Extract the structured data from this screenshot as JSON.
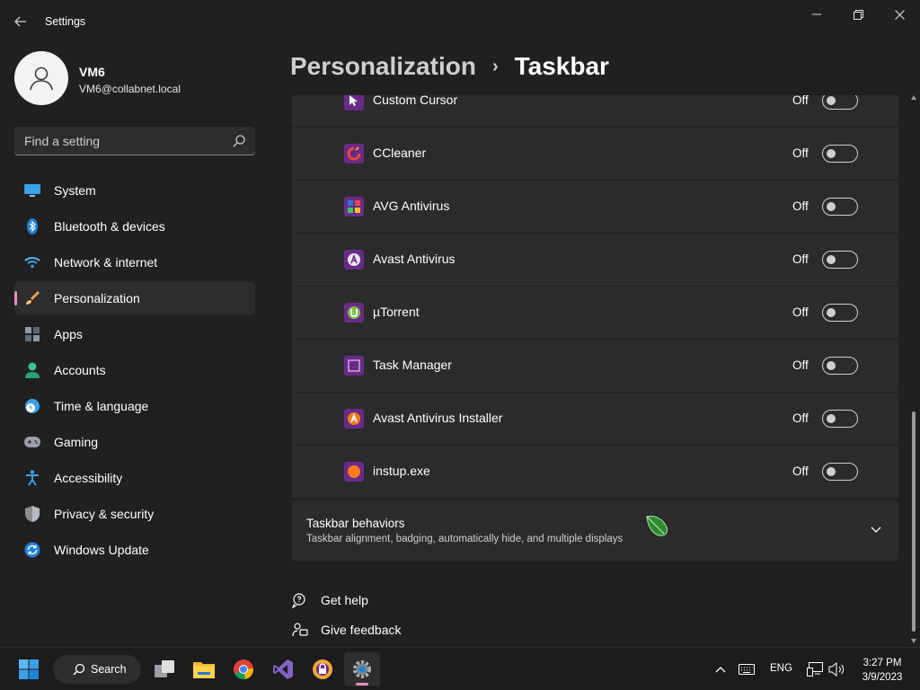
{
  "window": {
    "app_title": "Settings"
  },
  "profile": {
    "name": "VM6",
    "email": "VM6@collabnet.local"
  },
  "search": {
    "placeholder": "Find a setting"
  },
  "sidebar": {
    "items": [
      {
        "label": "System",
        "icon": "monitor-icon"
      },
      {
        "label": "Bluetooth & devices",
        "icon": "bluetooth-icon"
      },
      {
        "label": "Network & internet",
        "icon": "wifi-icon"
      },
      {
        "label": "Personalization",
        "icon": "brush-icon",
        "active": true
      },
      {
        "label": "Apps",
        "icon": "apps-icon"
      },
      {
        "label": "Accounts",
        "icon": "person-icon"
      },
      {
        "label": "Time & language",
        "icon": "globe-clock-icon"
      },
      {
        "label": "Gaming",
        "icon": "gamepad-icon"
      },
      {
        "label": "Accessibility",
        "icon": "accessibility-icon"
      },
      {
        "label": "Privacy & security",
        "icon": "shield-icon"
      },
      {
        "label": "Windows Update",
        "icon": "update-icon"
      }
    ]
  },
  "header": {
    "parent": "Personalization",
    "separator": "›",
    "current": "Taskbar"
  },
  "apps": [
    {
      "label": "Custom Cursor",
      "state": "Off",
      "icon": "cursor-app-icon"
    },
    {
      "label": "CCleaner",
      "state": "Off",
      "icon": "ccleaner-icon"
    },
    {
      "label": "AVG Antivirus",
      "state": "Off",
      "icon": "avg-icon"
    },
    {
      "label": "Avast Antivirus",
      "state": "Off",
      "icon": "avast-icon"
    },
    {
      "label": "µTorrent",
      "state": "Off",
      "icon": "utorrent-icon"
    },
    {
      "label": "Task Manager",
      "state": "Off",
      "icon": "task-manager-icon"
    },
    {
      "label": "Avast Antivirus Installer",
      "state": "Off",
      "icon": "avast-installer-icon"
    },
    {
      "label": "instup.exe",
      "state": "Off",
      "icon": "instup-icon"
    }
  ],
  "behaviors": {
    "title": "Taskbar behaviors",
    "subtitle": "Taskbar alignment, badging, automatically hide, and multiple displays"
  },
  "links": {
    "help": "Get help",
    "feedback": "Give feedback"
  },
  "taskbar": {
    "search_label": "Search",
    "language": "ENG",
    "time": "3:27 PM",
    "date": "3/9/2023",
    "accent": "#e38dc7"
  },
  "colors": {
    "accent": "#e38dc7",
    "background": "#202020",
    "card": "#2b2b2b"
  }
}
